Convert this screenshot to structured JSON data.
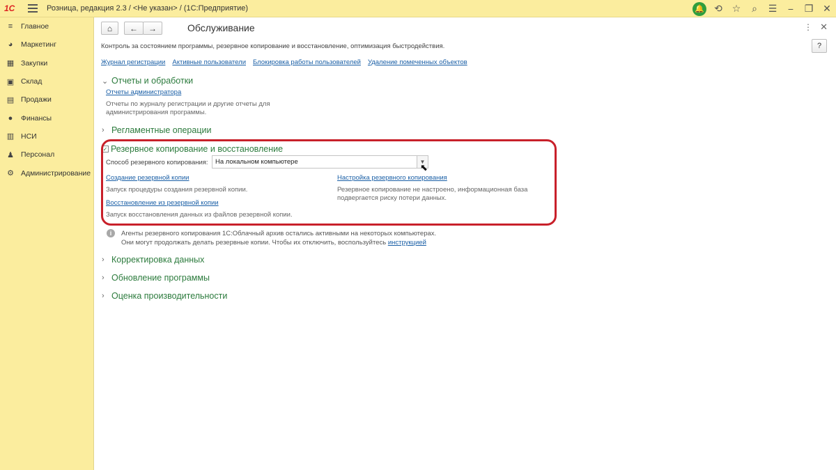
{
  "titlebar": {
    "logo": "1С",
    "title": "Розница, редакция 2.3 / <Не указан> /  (1С:Предприятие)"
  },
  "sidebar": {
    "items": [
      {
        "label": "Главное",
        "icon": "list-icon"
      },
      {
        "label": "Маркетинг",
        "icon": "pie-icon"
      },
      {
        "label": "Закупки",
        "icon": "cart-icon"
      },
      {
        "label": "Склад",
        "icon": "warehouse-icon"
      },
      {
        "label": "Продажи",
        "icon": "sales-icon"
      },
      {
        "label": "Финансы",
        "icon": "coin-icon"
      },
      {
        "label": "НСИ",
        "icon": "book-icon"
      },
      {
        "label": "Персонал",
        "icon": "person-icon"
      },
      {
        "label": "Администрирование",
        "icon": "gear-icon"
      }
    ]
  },
  "page": {
    "title": "Обслуживание",
    "description": "Контроль за состоянием программы, резервное копирование и восстановление, оптимизация быстродействия.",
    "help_label": "?",
    "top_links": [
      "Журнал регистрации",
      "Активные пользователи",
      "Блокировка работы пользователей",
      "Удаление помеченных объектов"
    ]
  },
  "sections": {
    "reports": {
      "title": "Отчеты и обработки",
      "link": "Отчеты администратора",
      "text1": "Отчеты по журналу регистрации и другие отчеты для",
      "text2": "администрирования программы."
    },
    "routine": {
      "title": "Регламентные операции"
    },
    "backup": {
      "title": "Резервное копирование и восстановление",
      "method_label": "Способ резервного копирования:",
      "method_value": "На локальном компьютере",
      "create_link": "Создание резервной копии",
      "create_text": "Запуск процедуры создания резервной копии.",
      "restore_link": "Восстановление из резервной копии",
      "restore_text": "Запуск восстановления данных из файлов резервной копии.",
      "settings_link": "Настройка резервного копирования",
      "settings_text1": "Резервное копирование не настроено, информационная база",
      "settings_text2": "подвергается риску потери данных."
    },
    "info": {
      "line1": "Агенты резервного копирования 1С:Облачный архив остались активными на некоторых компьютерах.",
      "line2": "Они могут продолжать делать резервные копии. Чтобы их отключить, воспользуйтесь",
      "link": "инструкцией"
    },
    "correction": {
      "title": "Корректировка данных"
    },
    "update": {
      "title": "Обновление программы"
    },
    "performance": {
      "title": "Оценка производительности"
    }
  }
}
